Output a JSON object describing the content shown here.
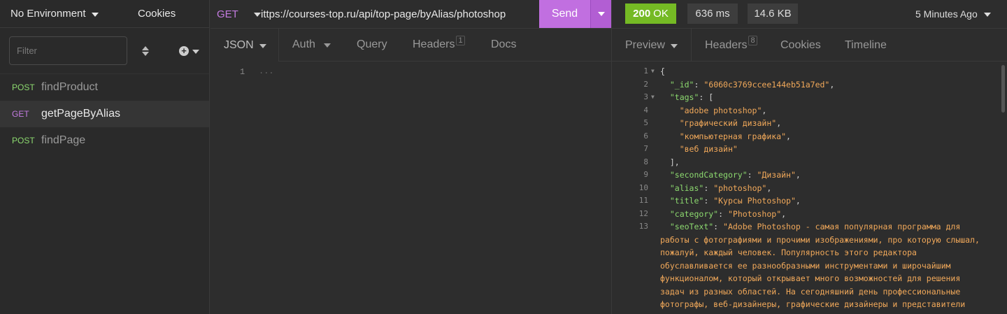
{
  "sidebar": {
    "environment": "No Environment",
    "cookies": "Cookies",
    "filter_placeholder": "Filter",
    "requests": [
      {
        "method": "POST",
        "name": "findProduct"
      },
      {
        "method": "GET",
        "name": "getPageByAlias"
      },
      {
        "method": "POST",
        "name": "findPage"
      }
    ]
  },
  "request": {
    "method": "GET",
    "url": "ittps://courses-top.ru/api/top-page/byAlias/photoshop",
    "send_label": "Send",
    "tabs": {
      "body": "JSON",
      "auth": "Auth",
      "query": "Query",
      "headers": "Headers",
      "headers_count": "1",
      "docs": "Docs"
    },
    "editor_line": "1",
    "editor_placeholder": "..."
  },
  "response": {
    "status_code": "200",
    "status_text": "OK",
    "time": "636 ms",
    "size": "14.6 KB",
    "ago": "5 Minutes Ago",
    "tabs": {
      "preview": "Preview",
      "headers": "Headers",
      "headers_count": "8",
      "cookies": "Cookies",
      "timeline": "Timeline"
    },
    "body_lines": [
      {
        "num": "1",
        "fold": true,
        "text": "{"
      },
      {
        "num": "2",
        "key": "_id",
        "value": "6060c3769ccee144eb51a7ed",
        "suffix": ","
      },
      {
        "num": "3",
        "fold": true,
        "key": "tags",
        "suffix": ": ["
      },
      {
        "num": "4",
        "value": "adobe photoshop",
        "suffix": ",",
        "indent": 2
      },
      {
        "num": "5",
        "value": "графический дизайн",
        "suffix": ",",
        "indent": 2
      },
      {
        "num": "6",
        "value": "компьютерная графика",
        "suffix": ",",
        "indent": 2
      },
      {
        "num": "7",
        "value": "веб дизайн",
        "suffix": "",
        "indent": 2
      },
      {
        "num": "8",
        "text": "],",
        "indent": 1
      },
      {
        "num": "9",
        "key": "secondCategory",
        "value": "Дизайн",
        "suffix": ","
      },
      {
        "num": "10",
        "key": "alias",
        "value": "photoshop",
        "suffix": ","
      },
      {
        "num": "11",
        "key": "title",
        "value": "Курсы Photoshop",
        "suffix": ","
      },
      {
        "num": "12",
        "key": "category",
        "value": "Photoshop",
        "suffix": ","
      },
      {
        "num": "13",
        "key": "seoText",
        "value_start": "\"Adobe Photoshop - самая популярная программа для"
      },
      {
        "cont": "работы с фотографиями и прочими изображениями, про которую слышал,"
      },
      {
        "cont": "пожалуй, каждый человек. Популярность этого редактора"
      },
      {
        "cont": "обуславливается ее разнообразными инструментами и широчайшим"
      },
      {
        "cont": "функционалом, который открывает много возможностей для решения"
      },
      {
        "cont": "задач из разных областей. На сегодняшний день профессиональные"
      },
      {
        "cont": "фотографы, веб-дизайнеры, графические дизайнеры и представители"
      }
    ]
  }
}
